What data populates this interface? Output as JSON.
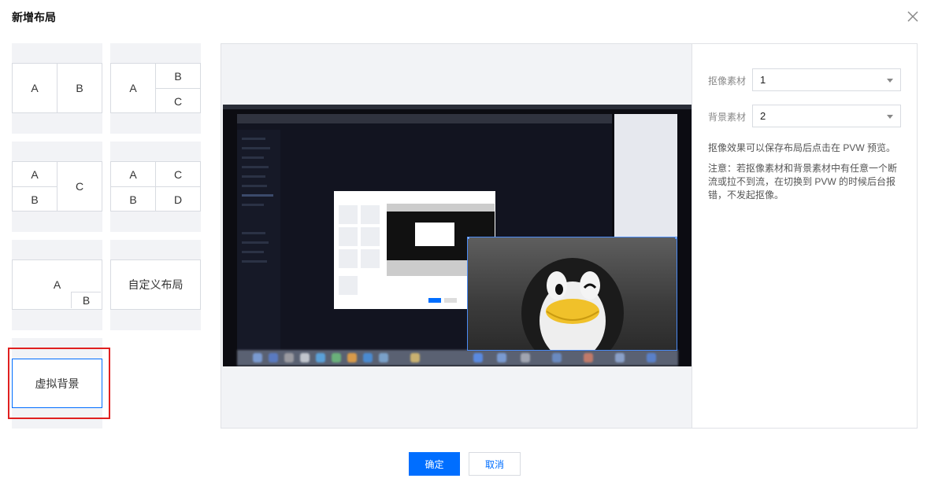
{
  "dialog": {
    "title": "新增布局",
    "close_icon": "close-icon"
  },
  "layouts": [
    {
      "id": "ab",
      "cells": [
        "A",
        "B"
      ]
    },
    {
      "id": "a-bc",
      "cells": [
        "A",
        "B",
        "C"
      ]
    },
    {
      "id": "ab-c",
      "cells": [
        "A",
        "B",
        "C"
      ]
    },
    {
      "id": "abcd",
      "cells": [
        "A",
        "C",
        "B",
        "D"
      ]
    },
    {
      "id": "pip",
      "cells": [
        "A",
        "B"
      ]
    },
    {
      "id": "custom",
      "label": "自定义布局"
    },
    {
      "id": "virtual-bg",
      "label": "虚拟背景",
      "selected": true
    }
  ],
  "form": {
    "camera_label": "抠像素材",
    "camera_value": "1",
    "background_label": "背景素材",
    "background_value": "2",
    "tip": "抠像效果可以保存布局后点击在 PVW 预览。",
    "note": "注意：若抠像素材和背景素材中有任意一个断流或拉不到流，在切换到 PVW 的时候后台报错，不发起抠像。"
  },
  "footer": {
    "confirm": "确定",
    "cancel": "取消"
  },
  "colors": {
    "primary": "#006eff",
    "highlight": "#e02020",
    "thumb_bg": "#f2f3f6",
    "border": "#d8dbe1"
  }
}
